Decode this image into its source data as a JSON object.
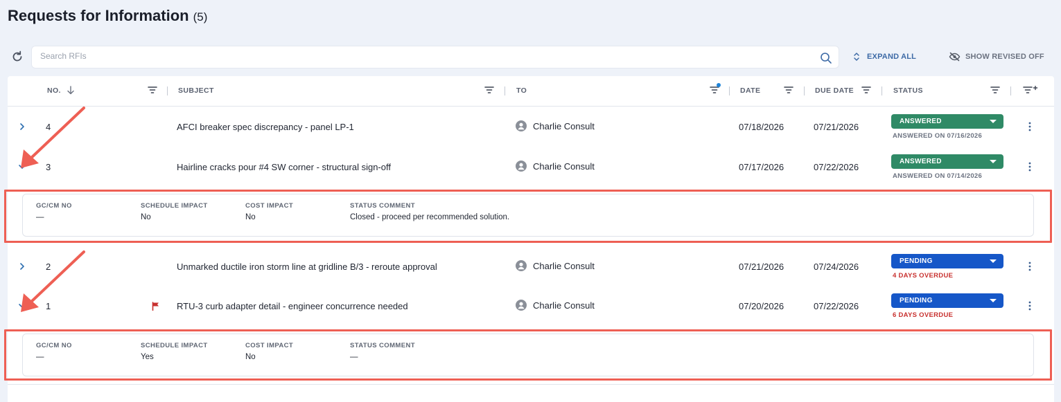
{
  "header": {
    "title": "Requests for Information",
    "count": "(5)"
  },
  "toolbar": {
    "search_placeholder": "Search RFIs",
    "expand_all": "EXPAND ALL",
    "show_revised": "SHOW REVISED OFF"
  },
  "columns": {
    "no": "NO.",
    "subject": "SUBJECT",
    "to": "TO",
    "date": "DATE",
    "due_date": "DUE DATE",
    "status": "STATUS"
  },
  "rows": [
    {
      "no": "4",
      "subject": "AFCI breaker spec discrepancy - panel LP-1",
      "to": "Charlie Consult",
      "date": "07/18/2026",
      "due": "07/21/2026",
      "status": "ANSWERED",
      "status_note": "ANSWERED ON 07/16/2026",
      "expanded": false,
      "flag": false
    },
    {
      "no": "3",
      "subject": "Hairline cracks pour #4 SW corner - structural sign-off",
      "to": "Charlie Consult",
      "date": "07/17/2026",
      "due": "07/22/2026",
      "status": "ANSWERED",
      "status_note": "ANSWERED ON 07/14/2026",
      "expanded": true,
      "flag": false
    },
    {
      "no": "2",
      "subject": "Unmarked ductile iron storm line at gridline B/3 - reroute approval",
      "to": "Charlie Consult",
      "date": "07/21/2026",
      "due": "07/24/2026",
      "status": "PENDING",
      "status_note": "4 DAYS OVERDUE",
      "expanded": false,
      "flag": false
    },
    {
      "no": "1",
      "subject": "RTU-3 curb adapter detail - engineer concurrence needed",
      "to": "Charlie Consult",
      "date": "07/20/2026",
      "due": "07/22/2026",
      "status": "PENDING",
      "status_note": "6 DAYS OVERDUE",
      "expanded": true,
      "flag": true
    }
  ],
  "details": {
    "labels": {
      "gccm": "GC/CM NO",
      "schedule": "SCHEDULE IMPACT",
      "cost": "COST IMPACT",
      "comment": "STATUS COMMENT"
    },
    "rfi3": {
      "gccm": "—",
      "schedule": "No",
      "cost": "No",
      "comment": "Closed - proceed per recommended solution."
    },
    "rfi1": {
      "gccm": "—",
      "schedule": "Yes",
      "cost": "No",
      "comment": "—"
    }
  },
  "colors": {
    "answered": "#2f8a66",
    "pending": "#1657c8",
    "overdue": "#c8312f",
    "annotation": "#ee5f54",
    "flag": "#c8312f"
  },
  "icons": [
    "refresh-icon",
    "search-icon",
    "expand-icon",
    "eye-off-icon",
    "filter-icon",
    "add-filter-icon",
    "chevron-right-icon",
    "chevron-down-icon",
    "user-icon",
    "flag-icon",
    "kebab-icon",
    "sort-down-icon"
  ]
}
